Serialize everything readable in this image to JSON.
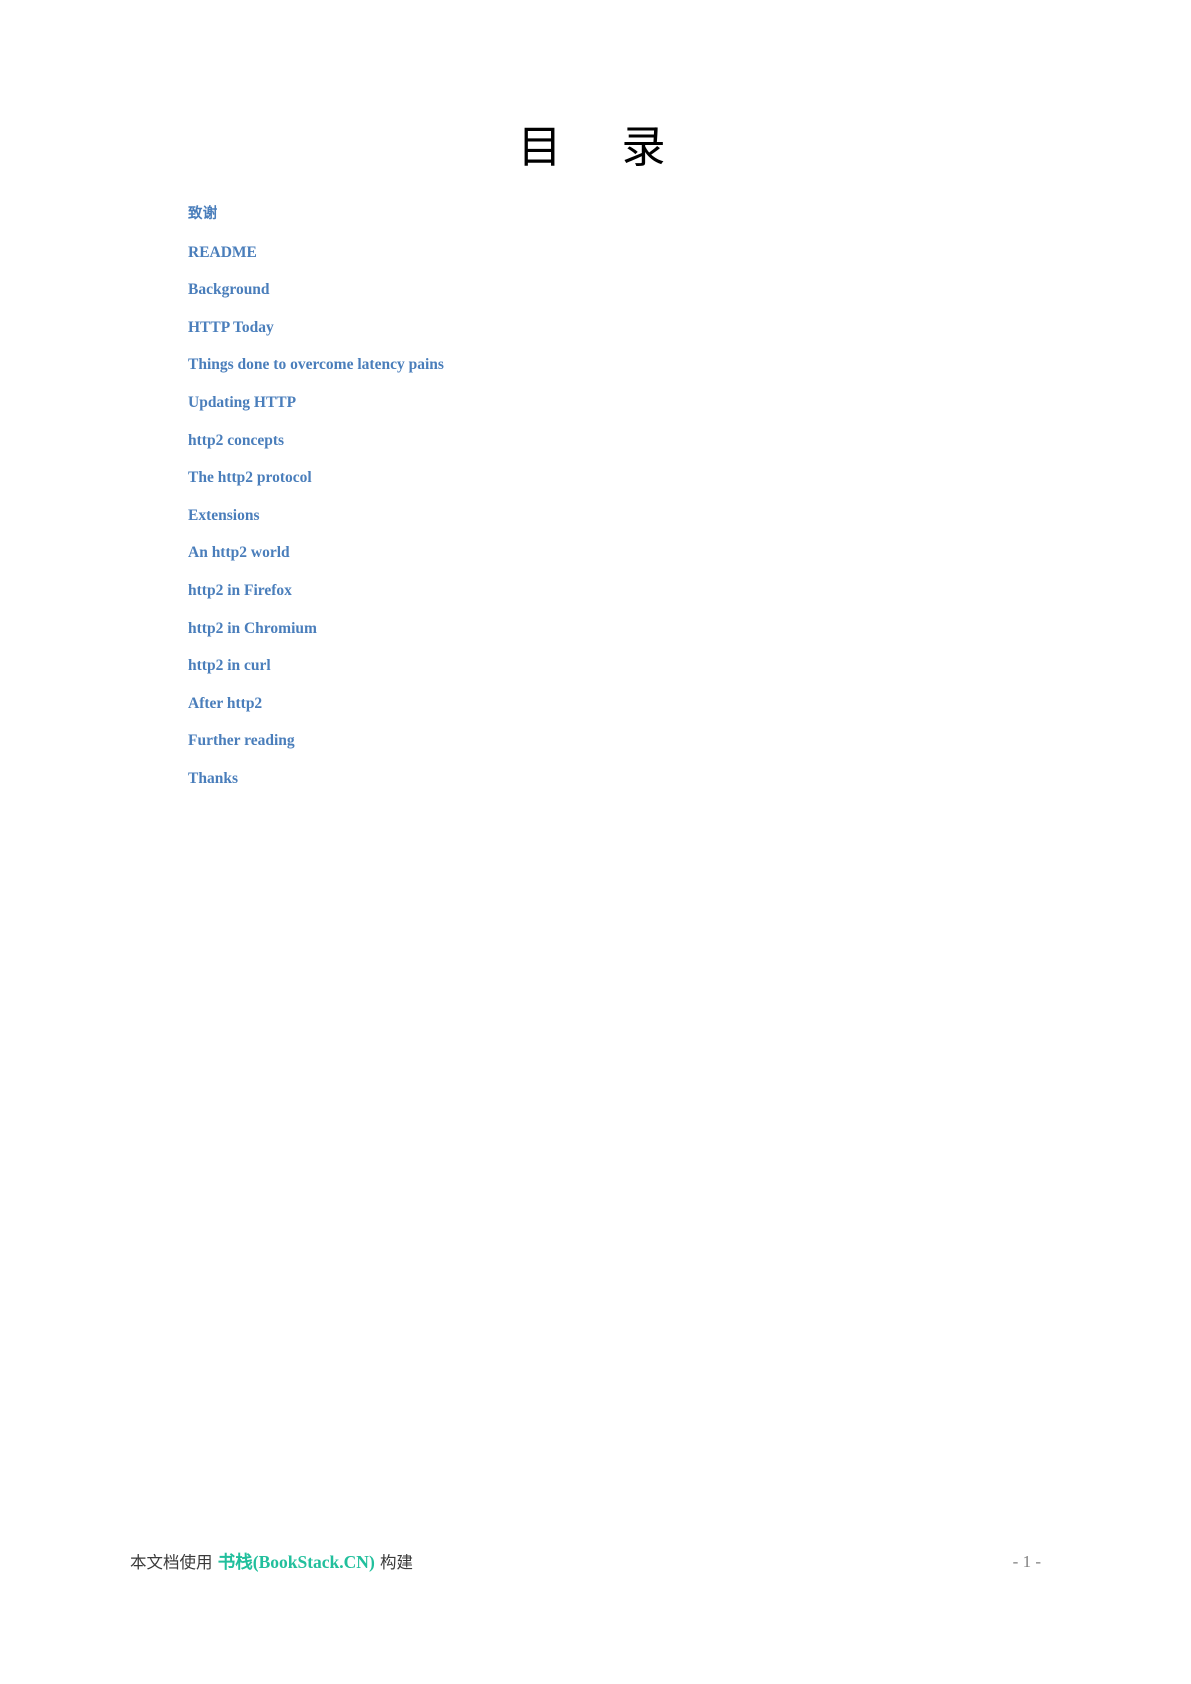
{
  "document": {
    "title": "目　录",
    "background_color": "#ffffff"
  },
  "colors": {
    "link": "#4a7ebb",
    "title": "#000000",
    "brand": "#21bf9c",
    "footer_text": "#3a3a3a",
    "page_number": "#808080"
  },
  "toc": {
    "items": [
      {
        "label": "致谢",
        "script": "cjk"
      },
      {
        "label": "README",
        "script": "latin"
      },
      {
        "label": "Background",
        "script": "latin"
      },
      {
        "label": "HTTP Today",
        "script": "latin"
      },
      {
        "label": "Things done to overcome latency pains",
        "script": "latin"
      },
      {
        "label": "Updating HTTP",
        "script": "latin"
      },
      {
        "label": "http2 concepts",
        "script": "latin"
      },
      {
        "label": "The http2 protocol",
        "script": "latin"
      },
      {
        "label": "Extensions",
        "script": "latin"
      },
      {
        "label": "An http2 world",
        "script": "latin"
      },
      {
        "label": "http2 in Firefox",
        "script": "latin"
      },
      {
        "label": "http2 in Chromium",
        "script": "latin"
      },
      {
        "label": "http2 in curl",
        "script": "latin"
      },
      {
        "label": "After http2",
        "script": "latin"
      },
      {
        "label": "Further reading",
        "script": "latin"
      },
      {
        "label": "Thanks",
        "script": "latin"
      }
    ]
  },
  "footer": {
    "credit_prefix": "本文档使用 ",
    "credit_brand": "书栈(BookStack.CN)",
    "credit_suffix": " 构建",
    "page_number": "- 1 -"
  }
}
